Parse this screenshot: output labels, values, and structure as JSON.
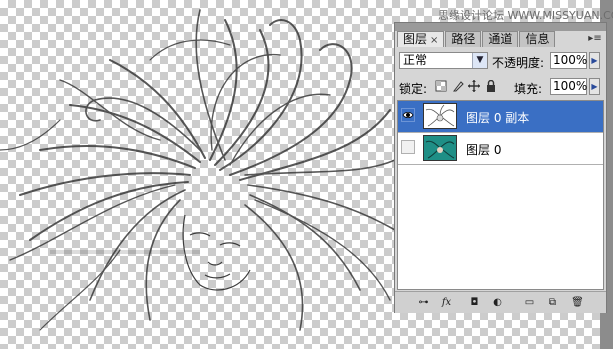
{
  "watermark": "思缘设计论坛 WWW.MISSYUAN.COM",
  "panel": {
    "tabs": [
      {
        "label": "图层",
        "close": "×",
        "active": true
      },
      {
        "label": "路径",
        "active": false
      },
      {
        "label": "通道",
        "active": false
      },
      {
        "label": "信息",
        "active": false
      }
    ],
    "menu_icon": "panel-menu-icon",
    "blend_mode": "正常",
    "opacity_label": "不透明度:",
    "opacity_value": "100%",
    "lock_label": "锁定:",
    "fill_label": "填充:",
    "fill_value": "100%",
    "layers": [
      {
        "name": "图层 0 副本",
        "visible": true,
        "selected": true
      },
      {
        "name": "图层 0",
        "visible": false,
        "selected": false
      }
    ],
    "footer_icons": [
      "link-layers-icon",
      "fx-icon",
      "add-mask-icon",
      "adjustment-layer-icon",
      "new-group-icon",
      "new-layer-icon",
      "delete-icon"
    ],
    "colors": {
      "selection": "#3a6fc4",
      "panel_bg": "#d6d6d6"
    }
  }
}
